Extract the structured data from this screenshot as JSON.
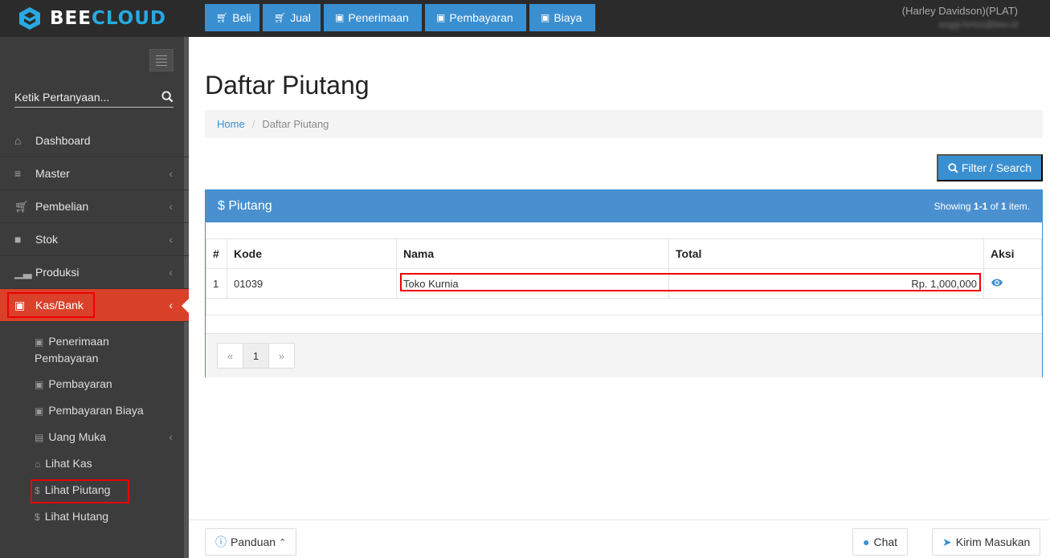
{
  "brand": {
    "name_part1": "BEE",
    "name_part2": "CLOUD"
  },
  "top_actions": [
    {
      "label": "Beli",
      "icon": "cart-icon"
    },
    {
      "label": "Jual",
      "icon": "cart-icon"
    },
    {
      "label": "Penerimaan",
      "icon": "money-icon"
    },
    {
      "label": "Pembayaran",
      "icon": "money-icon"
    },
    {
      "label": "Biaya",
      "icon": "money-icon"
    }
  ],
  "user": {
    "company": "(Harley Davidson)(PLAT)",
    "email": "anggi.fortus@bee.id"
  },
  "sidebar": {
    "search_placeholder": "Ketik Pertanyaan...",
    "items": [
      {
        "label": "Dashboard",
        "icon": "home-icon"
      },
      {
        "label": "Master",
        "icon": "database-icon"
      },
      {
        "label": "Pembelian",
        "icon": "cart-icon"
      },
      {
        "label": "Stok",
        "icon": "box-icon"
      },
      {
        "label": "Produksi",
        "icon": "chart-icon"
      },
      {
        "label": "Kas/Bank",
        "icon": "money-icon"
      }
    ],
    "sub_items": [
      {
        "label": "Penerimaan Pembayaran",
        "icon": "money-icon"
      },
      {
        "label": "Pembayaran",
        "icon": "money-icon"
      },
      {
        "label": "Pembayaran Biaya",
        "icon": "money-icon"
      },
      {
        "label": "Uang Muka",
        "icon": "file-icon"
      },
      {
        "label": "Lihat Kas",
        "icon": "bank-icon"
      },
      {
        "label": "Lihat Piutang",
        "icon": "dollar-icon"
      },
      {
        "label": "Lihat Hutang",
        "icon": "dollar-icon"
      }
    ]
  },
  "page": {
    "title": "Daftar Piutang",
    "breadcrumb": {
      "home": "Home",
      "current": "Daftar Piutang"
    },
    "filter_button": "Filter / Search"
  },
  "panel": {
    "title": "$ Piutang",
    "summary_prefix": "Showing",
    "summary_range": "1-1",
    "summary_of": "of",
    "summary_total": "1",
    "summary_suffix": "item."
  },
  "table": {
    "headers": [
      "#",
      "Kode",
      "Nama",
      "Total",
      "Aksi"
    ],
    "rows": [
      {
        "no": "1",
        "kode": "01039",
        "nama": "Toko Kurnia",
        "total": "Rp. 1,000,000"
      }
    ]
  },
  "pagination": {
    "prev": "«",
    "page": "1",
    "next": "»"
  },
  "footer": {
    "guide": "Panduan",
    "chat": "Chat",
    "feedback": "Kirim Masukan"
  },
  "colors": {
    "primary": "#3a8fd0",
    "active_menu": "#d9412a",
    "highlight": "#ee0000",
    "topbar": "#2b2b2b",
    "sidebar": "#3c3c3c"
  }
}
